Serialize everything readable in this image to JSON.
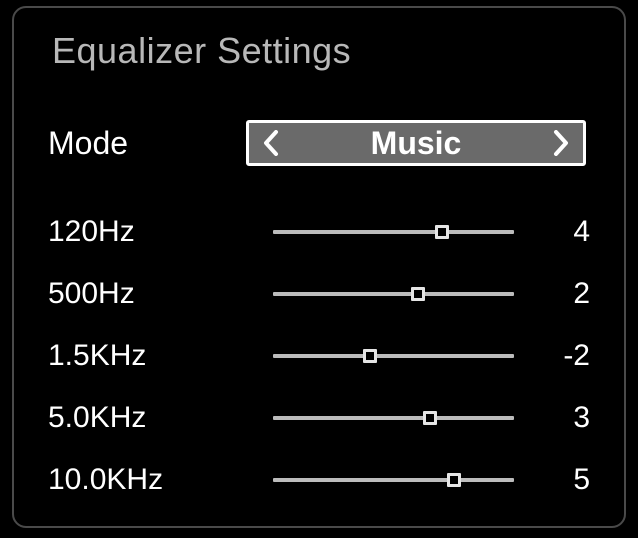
{
  "title": "Equalizer Settings",
  "mode": {
    "label": "Mode",
    "value": "Music"
  },
  "slider": {
    "min": -10,
    "max": 10
  },
  "bands": [
    {
      "label": "120Hz",
      "value": 4
    },
    {
      "label": "500Hz",
      "value": 2
    },
    {
      "label": "1.5KHz",
      "value": -2
    },
    {
      "label": "5.0KHz",
      "value": 3
    },
    {
      "label": "10.0KHz",
      "value": 5
    }
  ]
}
